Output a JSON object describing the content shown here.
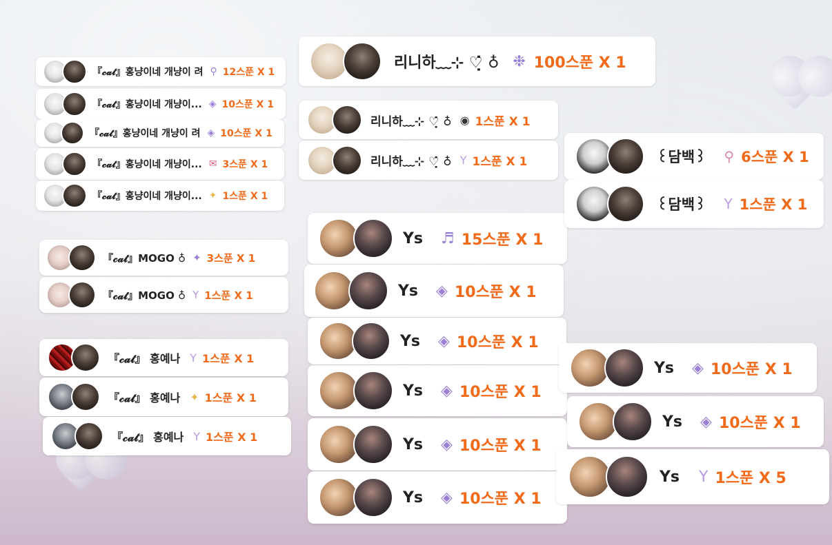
{
  "colors": {
    "amount": "#f06a1a",
    "name": "#222222",
    "card": "#ffffff"
  },
  "cards": [
    {
      "name": "『𝓬𝓪𝓽』홍냥이네 개냥이 려",
      "icon": "lollipop-icon",
      "amount": "12스푼 X 1"
    },
    {
      "name": "『𝓬𝓪𝓽』홍냥이네 개냥이...",
      "icon": "gem-icon",
      "amount": "10스푼 X 1"
    },
    {
      "name": "『𝓬𝓪𝓽』홍냥이네 개냥이 려",
      "icon": "gem-icon",
      "amount": "10스푼 X 1"
    },
    {
      "name": "『𝓬𝓪𝓽』홍냥이네 개냥이...",
      "icon": "envelope-icon",
      "amount": "3스푼 X 1"
    },
    {
      "name": "『𝓬𝓪𝓽』홍냥이네 개냥이...",
      "icon": "sparkle-star-icon",
      "amount": "1스푼 X 1"
    },
    {
      "name": "『𝓬𝓪𝓽』MOGO ♁",
      "icon": "sparkle-star-icon",
      "amount": "3스푼 X 1"
    },
    {
      "name": "『𝓬𝓪𝓽』MOGO ♁",
      "icon": "cocktail-icon",
      "amount": "1스푼 X 1"
    },
    {
      "name": "『𝓬𝓪𝓽』 홍예나",
      "icon": "cocktail-icon",
      "amount": "1스푼 X 1"
    },
    {
      "name": "『𝓬𝓪𝓽』 홍예나",
      "icon": "sparkle-star-icon",
      "amount": "1스푼 X 1"
    },
    {
      "name": "『𝓬𝓪𝓽』 홍예나",
      "icon": "cocktail-icon",
      "amount": "1스푼 X 1"
    },
    {
      "name": "리니하﹏⊹ ♡̣̇̇ ♁",
      "icon": "gem-cluster-icon",
      "amount": "100스푼 X 1"
    },
    {
      "name": "리니하﹏⊹ ♡̣̇̇ ♁",
      "icon": "wifi-badge-icon",
      "amount": "1스푼 X 1"
    },
    {
      "name": "리니하﹏⊹ ♡̣̇̇ ♁",
      "icon": "cocktail-icon",
      "amount": "1스푼 X 1"
    },
    {
      "name": "Ys",
      "icon": "piano-icon",
      "amount": "15스푼 X 1"
    },
    {
      "name": "Ys",
      "icon": "gem-icon",
      "amount": "10스푼 X 1"
    },
    {
      "name": "Ys",
      "icon": "gem-icon",
      "amount": "10스푼 X 1"
    },
    {
      "name": "Ys",
      "icon": "gem-icon",
      "amount": "10스푼 X 1"
    },
    {
      "name": "Ys",
      "icon": "gem-icon",
      "amount": "10스푼 X 1"
    },
    {
      "name": "Ys",
      "icon": "gem-icon",
      "amount": "10스푼 X 1"
    },
    {
      "name": "꒰담백꒱",
      "icon": "lollipop-icon",
      "amount": "6스푼 X 1"
    },
    {
      "name": "꒰담백꒱",
      "icon": "cocktail-icon",
      "amount": "1스푼 X 1"
    },
    {
      "name": "Ys",
      "icon": "gem-icon",
      "amount": "10스푼 X 1"
    },
    {
      "name": "Ys",
      "icon": "gem-icon",
      "amount": "10스푼 X 1"
    },
    {
      "name": "Ys",
      "icon": "cocktail-icon",
      "amount": "1스푼 X 5"
    }
  ],
  "icons": {
    "lollipop-icon": "⚲",
    "gem-icon": "◈",
    "gem-cluster-icon": "❉",
    "envelope-icon": "✉",
    "sparkle-star-icon": "✦",
    "cocktail-icon": "Y",
    "wifi-badge-icon": "◉",
    "piano-icon": "♬"
  }
}
